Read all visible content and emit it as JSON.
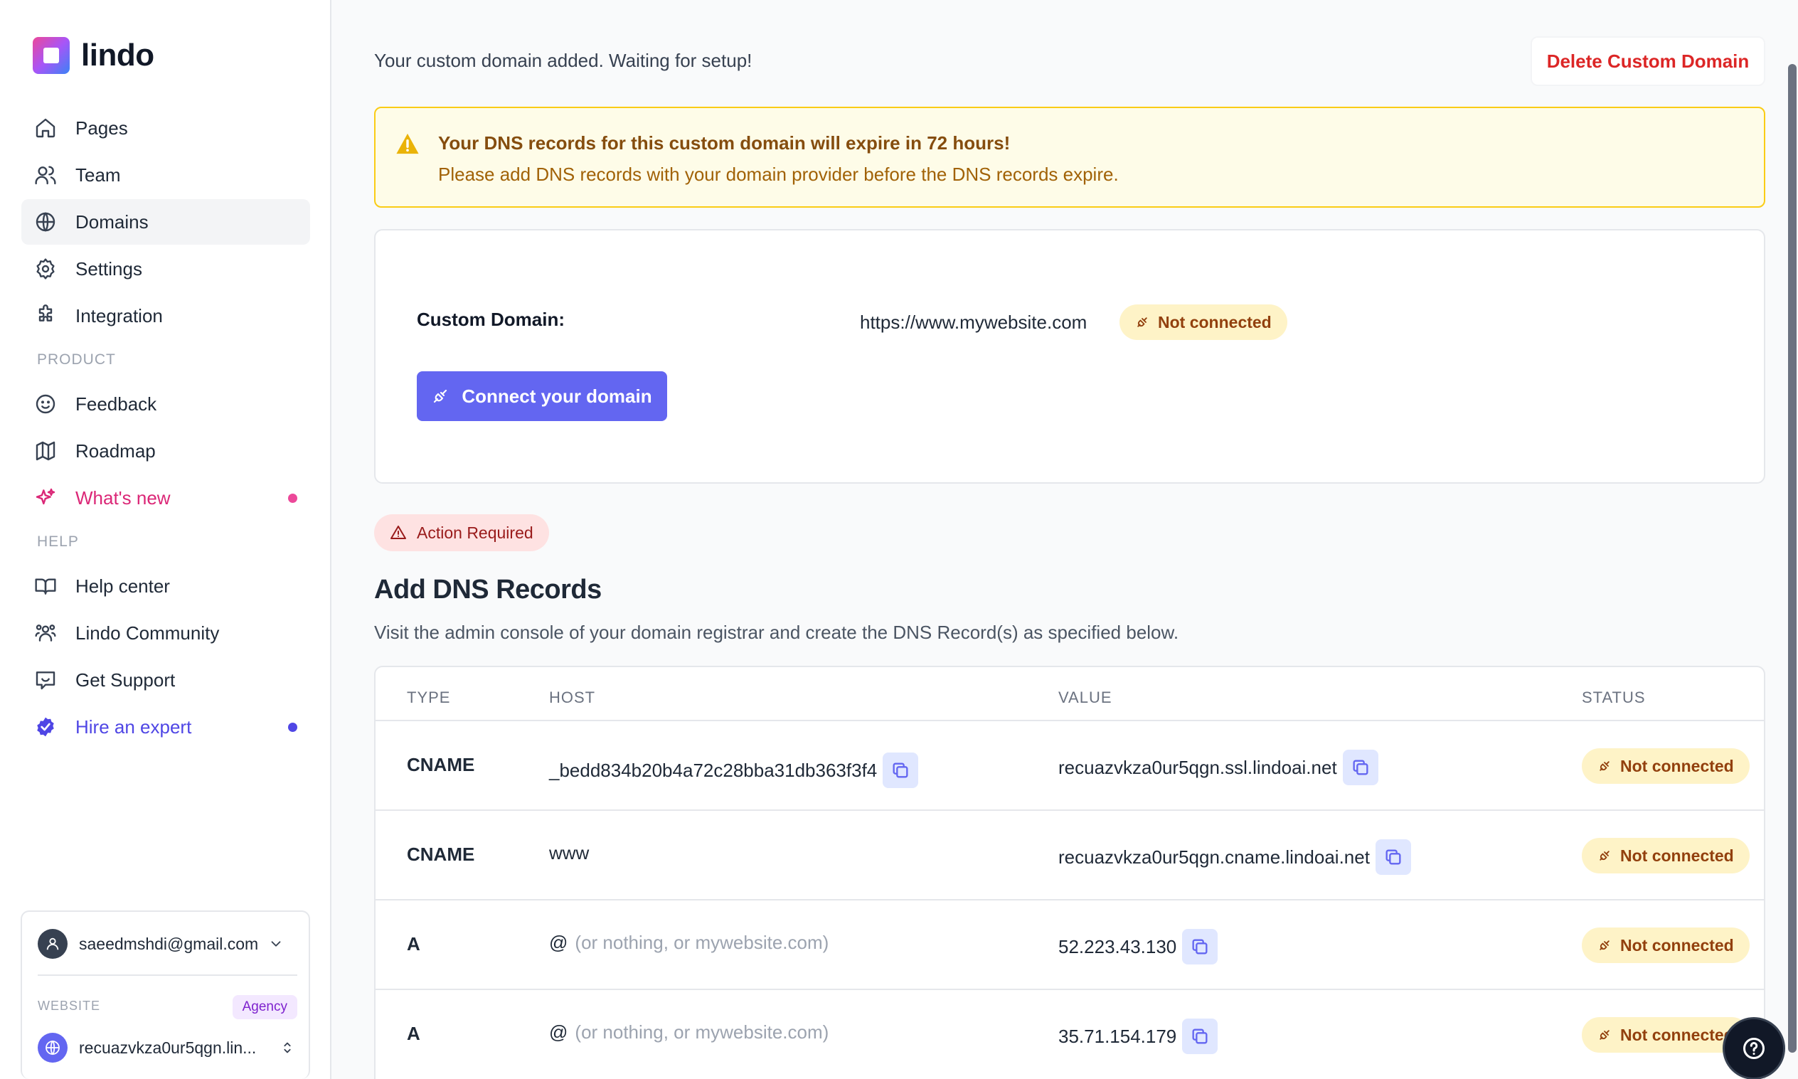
{
  "brand": {
    "name": "lindo"
  },
  "sidebar": {
    "items": [
      {
        "label": "Pages",
        "icon": "home-icon"
      },
      {
        "label": "Team",
        "icon": "users-icon"
      },
      {
        "label": "Domains",
        "icon": "globe-icon",
        "active": true
      },
      {
        "label": "Settings",
        "icon": "gear-icon"
      },
      {
        "label": "Integration",
        "icon": "puzzle-icon"
      }
    ],
    "product_label": "PRODUCT",
    "product_items": [
      {
        "label": "Feedback",
        "icon": "smile-icon"
      },
      {
        "label": "Roadmap",
        "icon": "map-icon"
      },
      {
        "label": "What's new",
        "icon": "sparkles-icon"
      }
    ],
    "help_label": "HELP",
    "help_items": [
      {
        "label": "Help center",
        "icon": "book-icon"
      },
      {
        "label": "Lindo Community",
        "icon": "community-icon"
      },
      {
        "label": "Get Support",
        "icon": "chat-icon"
      },
      {
        "label": "Hire an expert",
        "icon": "verified-badge-icon"
      }
    ],
    "account": {
      "email": "saeedmshdi@gmail.com",
      "website_label": "WEBSITE",
      "plan_badge": "Agency",
      "website_name": "recuazvkza0ur5qgn.lin..."
    }
  },
  "main": {
    "top_message": "Your custom domain added. Waiting for setup!",
    "delete_button": "Delete Custom Domain",
    "warning": {
      "title": "Your DNS records for this custom domain will expire in 72 hours!",
      "text": "Please add DNS records with your domain provider before the DNS records expire."
    },
    "custom_domain": {
      "label": "Custom Domain:",
      "url": "https://www.mywebsite.com",
      "status": "Not connected",
      "connect_button": "Connect your domain"
    },
    "action_required": "Action Required",
    "dns_title": "Add DNS Records",
    "dns_subtitle": "Visit the admin console of your domain registrar and create the DNS Record(s) as specified below.",
    "table": {
      "headers": [
        "TYPE",
        "HOST",
        "VALUE",
        "STATUS"
      ],
      "rows": [
        {
          "type": "CNAME",
          "host": "_bedd834b20b4a72c28bba31db363f3f4",
          "host_hint": "",
          "value": "recuazvkza0ur5qgn.ssl.lindoai.net",
          "status": "Not connected"
        },
        {
          "type": "CNAME",
          "host": "www",
          "host_hint": "",
          "value": "recuazvkza0ur5qgn.cname.lindoai.net",
          "status": "Not connected"
        },
        {
          "type": "A",
          "host": "@",
          "host_hint": "(or nothing, or mywebsite.com)",
          "value": "52.223.43.130",
          "status": "Not connected"
        },
        {
          "type": "A",
          "host": "@",
          "host_hint": "(or nothing, or mywebsite.com)",
          "value": "35.71.154.179",
          "status": "Not connected"
        }
      ]
    }
  },
  "colors": {
    "accent": "#6366f1",
    "danger": "#dc2626",
    "warning_bg": "#fefce8",
    "warning_border": "#facc15",
    "status_pill_bg": "#fef3c7",
    "status_pill_text": "#92400e",
    "pink": "#db2777"
  }
}
